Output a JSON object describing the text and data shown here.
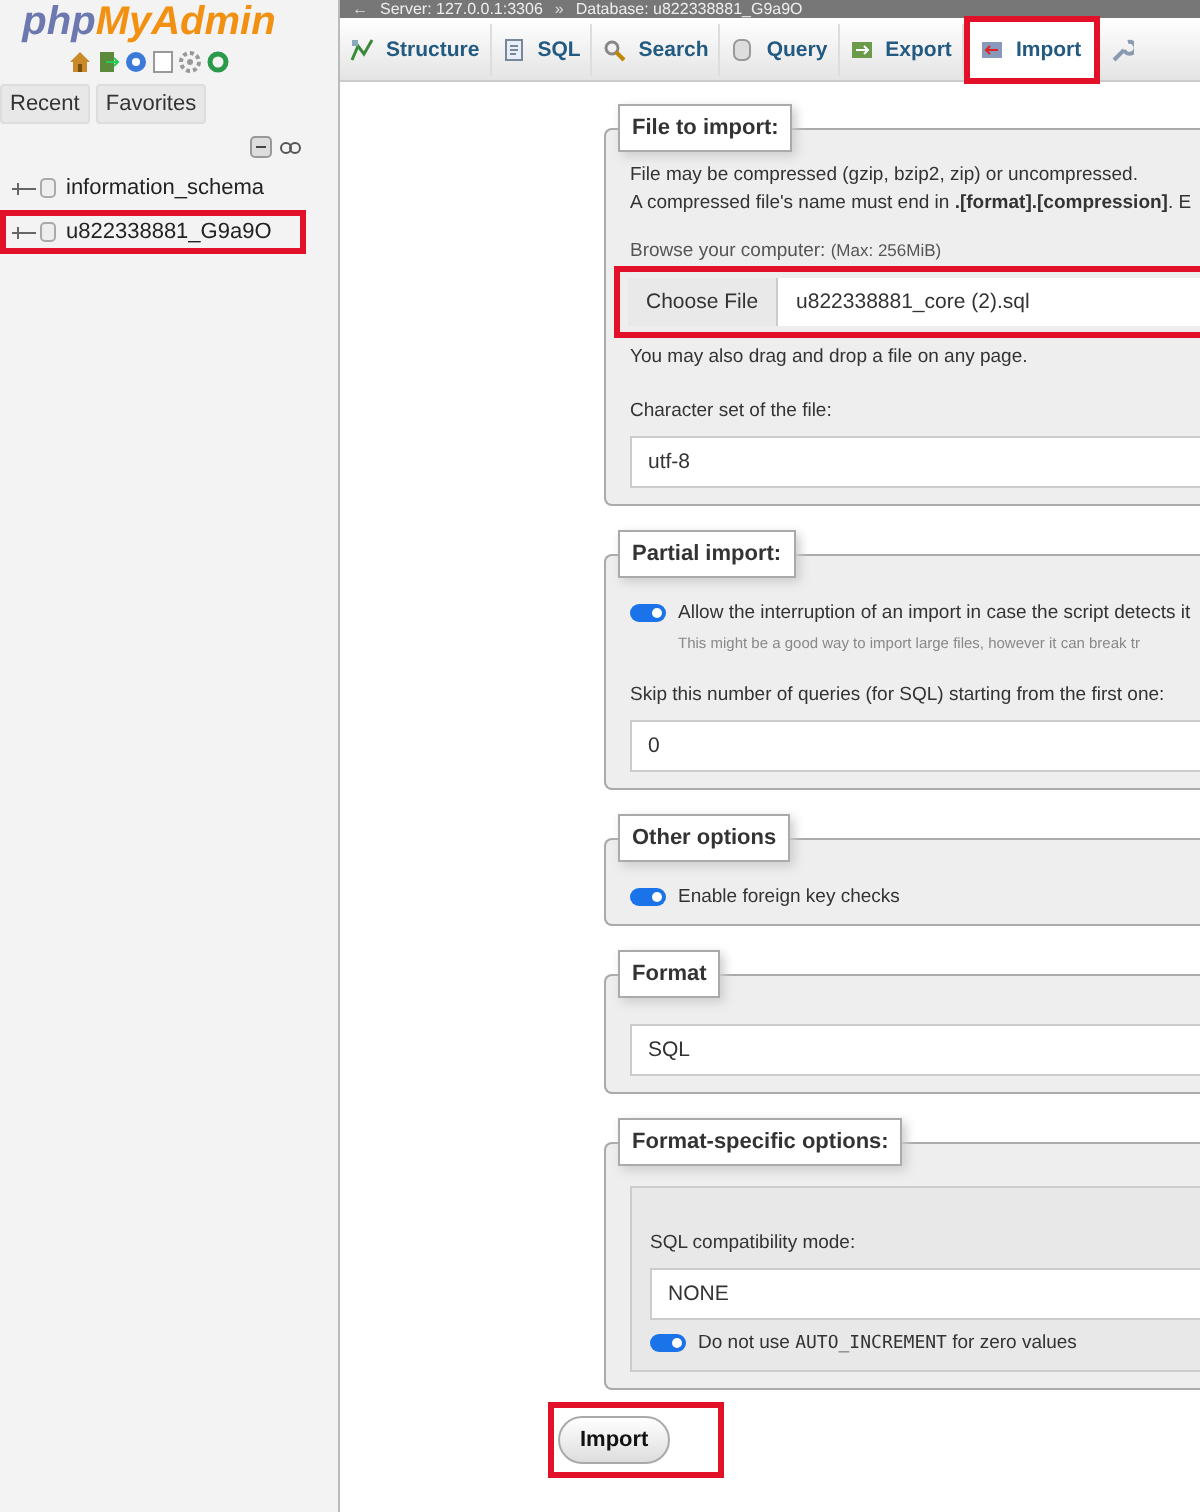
{
  "sidebar": {
    "logo": [
      "php",
      "MyAdmin"
    ],
    "nav_tabs": [
      {
        "label": "Recent",
        "selected": false
      },
      {
        "label": "Favorites",
        "selected": false
      }
    ],
    "tree": [
      {
        "label": "information_schema",
        "highlighted": false
      },
      {
        "label": "u822338881_G9a9O",
        "highlighted": true
      }
    ]
  },
  "breadcrumb": {
    "back": "←",
    "server": "Server: 127.0.0.1:3306",
    "separator": "»",
    "database": "Database: u822338881_G9a9O"
  },
  "tabs": [
    {
      "label": "Structure",
      "selected": false,
      "highlighted": false
    },
    {
      "label": "SQL",
      "selected": false,
      "highlighted": false
    },
    {
      "label": "Search",
      "selected": false,
      "highlighted": false
    },
    {
      "label": "Query",
      "selected": false,
      "highlighted": false
    },
    {
      "label": "Export",
      "selected": false,
      "highlighted": false
    },
    {
      "label": "Import",
      "selected": true,
      "highlighted": true
    }
  ],
  "file_to_import": {
    "legend": "File to import:",
    "note_1": "File may be compressed (gzip, bzip2, zip) or uncompressed.",
    "note_2": "A compressed file's name must end in **.[format].[compression]**. E",
    "browse_label": "Browse your computer:",
    "browse_max": "(Max: 256MiB)",
    "choose_button": "Choose File",
    "file_name": "u822338881_core (2).sql",
    "highlighted": true,
    "drag_note": "You may also drag and drop a file on any page.",
    "charset_label": "Character set of the file:",
    "charset": "utf-8"
  },
  "partial_import": {
    "legend": "Partial import:",
    "allow_interrupt": {
      "label": "Allow the interruption of an import in case the script detects it",
      "on": true
    },
    "hint": "This might be a good way to import large files, however it can break tr",
    "skip_label": "Skip this number of queries (for SQL) starting from the first one:",
    "skip_value": "0"
  },
  "other_options": {
    "legend": "Other options",
    "foreign_keys": {
      "label": "Enable foreign key checks",
      "on": true
    }
  },
  "format": {
    "legend": "Format",
    "value": "SQL"
  },
  "format_specific": {
    "legend": "Format-specific options:",
    "compat_label": "SQL compatibility mode:",
    "compat_value": "NONE",
    "no_auto_increment": {
      "label_before": "Do not use",
      "code": "AUTO_INCREMENT",
      "label_after": "for zero values",
      "on": true
    }
  },
  "import_button": {
    "label": "Import",
    "highlighted": true
  }
}
